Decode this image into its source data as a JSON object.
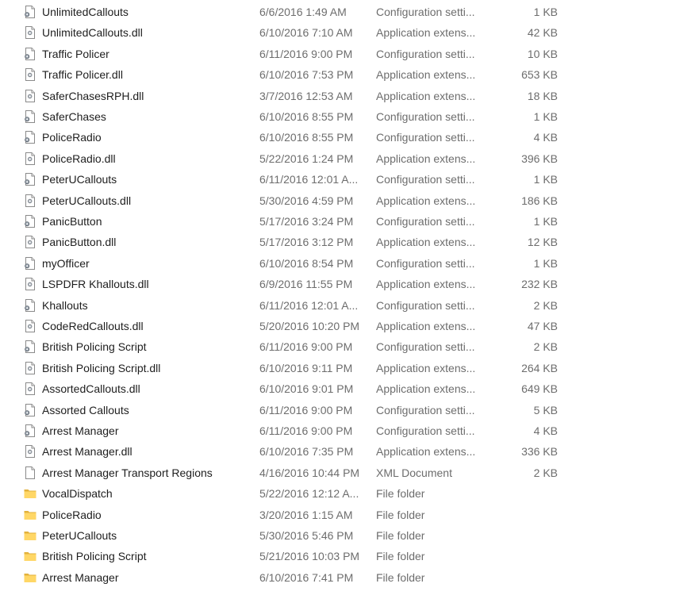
{
  "files": [
    {
      "name": "UnlimitedCallouts",
      "date": "6/6/2016 1:49 AM",
      "type": "Configuration setti...",
      "size": "1 KB",
      "icon": "config-file-icon"
    },
    {
      "name": "UnlimitedCallouts.dll",
      "date": "6/10/2016 7:10 AM",
      "type": "Application extens...",
      "size": "42 KB",
      "icon": "dll-file-icon"
    },
    {
      "name": "Traffic Policer",
      "date": "6/11/2016 9:00 PM",
      "type": "Configuration setti...",
      "size": "10 KB",
      "icon": "config-file-icon"
    },
    {
      "name": "Traffic Policer.dll",
      "date": "6/10/2016 7:53 PM",
      "type": "Application extens...",
      "size": "653 KB",
      "icon": "dll-file-icon"
    },
    {
      "name": "SaferChasesRPH.dll",
      "date": "3/7/2016 12:53 AM",
      "type": "Application extens...",
      "size": "18 KB",
      "icon": "dll-file-icon"
    },
    {
      "name": "SaferChases",
      "date": "6/10/2016 8:55 PM",
      "type": "Configuration setti...",
      "size": "1 KB",
      "icon": "config-file-icon"
    },
    {
      "name": "PoliceRadio",
      "date": "6/10/2016 8:55 PM",
      "type": "Configuration setti...",
      "size": "4 KB",
      "icon": "config-file-icon"
    },
    {
      "name": "PoliceRadio.dll",
      "date": "5/22/2016 1:24 PM",
      "type": "Application extens...",
      "size": "396 KB",
      "icon": "dll-file-icon"
    },
    {
      "name": "PeterUCallouts",
      "date": "6/11/2016 12:01 A...",
      "type": "Configuration setti...",
      "size": "1 KB",
      "icon": "config-file-icon"
    },
    {
      "name": "PeterUCallouts.dll",
      "date": "5/30/2016 4:59 PM",
      "type": "Application extens...",
      "size": "186 KB",
      "icon": "dll-file-icon"
    },
    {
      "name": "PanicButton",
      "date": "5/17/2016 3:24 PM",
      "type": "Configuration setti...",
      "size": "1 KB",
      "icon": "config-file-icon"
    },
    {
      "name": "PanicButton.dll",
      "date": "5/17/2016 3:12 PM",
      "type": "Application extens...",
      "size": "12 KB",
      "icon": "dll-file-icon"
    },
    {
      "name": "myOfficer",
      "date": "6/10/2016 8:54 PM",
      "type": "Configuration setti...",
      "size": "1 KB",
      "icon": "config-file-icon"
    },
    {
      "name": "LSPDFR Khallouts.dll",
      "date": "6/9/2016 11:55 PM",
      "type": "Application extens...",
      "size": "232 KB",
      "icon": "dll-file-icon"
    },
    {
      "name": "Khallouts",
      "date": "6/11/2016 12:01 A...",
      "type": "Configuration setti...",
      "size": "2 KB",
      "icon": "config-file-icon"
    },
    {
      "name": "CodeRedCallouts.dll",
      "date": "5/20/2016 10:20 PM",
      "type": "Application extens...",
      "size": "47 KB",
      "icon": "dll-file-icon"
    },
    {
      "name": "British Policing Script",
      "date": "6/11/2016 9:00 PM",
      "type": "Configuration setti...",
      "size": "2 KB",
      "icon": "config-file-icon"
    },
    {
      "name": "British Policing Script.dll",
      "date": "6/10/2016 9:11 PM",
      "type": "Application extens...",
      "size": "264 KB",
      "icon": "dll-file-icon"
    },
    {
      "name": "AssortedCallouts.dll",
      "date": "6/10/2016 9:01 PM",
      "type": "Application extens...",
      "size": "649 KB",
      "icon": "dll-file-icon"
    },
    {
      "name": "Assorted Callouts",
      "date": "6/11/2016 9:00 PM",
      "type": "Configuration setti...",
      "size": "5 KB",
      "icon": "config-file-icon"
    },
    {
      "name": "Arrest Manager",
      "date": "6/11/2016 9:00 PM",
      "type": "Configuration setti...",
      "size": "4 KB",
      "icon": "config-file-icon"
    },
    {
      "name": "Arrest Manager.dll",
      "date": "6/10/2016 7:35 PM",
      "type": "Application extens...",
      "size": "336 KB",
      "icon": "dll-file-icon"
    },
    {
      "name": "Arrest Manager Transport Regions",
      "date": "4/16/2016 10:44 PM",
      "type": "XML Document",
      "size": "2 KB",
      "icon": "xml-file-icon"
    },
    {
      "name": "VocalDispatch",
      "date": "5/22/2016 12:12 A...",
      "type": "File folder",
      "size": "",
      "icon": "folder-icon"
    },
    {
      "name": "PoliceRadio",
      "date": "3/20/2016 1:15 AM",
      "type": "File folder",
      "size": "",
      "icon": "folder-icon"
    },
    {
      "name": "PeterUCallouts",
      "date": "5/30/2016 5:46 PM",
      "type": "File folder",
      "size": "",
      "icon": "folder-icon"
    },
    {
      "name": "British Policing Script",
      "date": "5/21/2016 10:03 PM",
      "type": "File folder",
      "size": "",
      "icon": "folder-icon"
    },
    {
      "name": "Arrest Manager",
      "date": "6/10/2016 7:41 PM",
      "type": "File folder",
      "size": "",
      "icon": "folder-icon"
    }
  ]
}
